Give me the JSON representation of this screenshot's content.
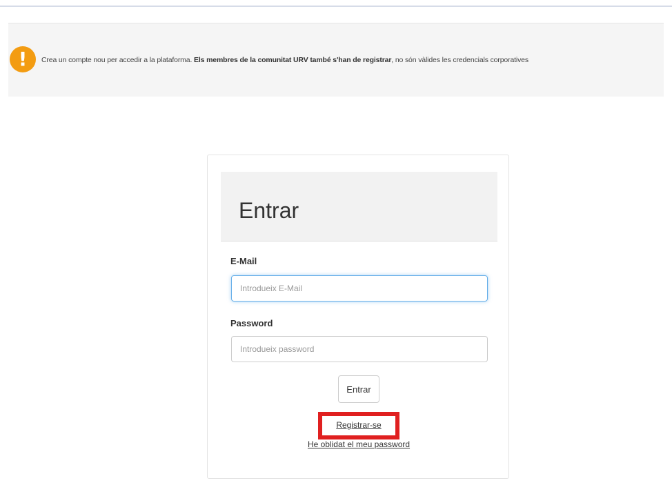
{
  "notice": {
    "icon": "exclamation-icon",
    "icon_glyph": "!",
    "icon_color": "#f39c12",
    "text_before": "Crea un compte nou per accedir a la plataforma. ",
    "text_bold": "Els membres de la comunitat URV també s'han de registrar",
    "text_after": ", no són vàlides les credencials corporatives"
  },
  "login": {
    "title": "Entrar",
    "email_label": "E-Mail",
    "email_placeholder": "Introdueix E-Mail",
    "email_value": "",
    "password_label": "Password",
    "password_placeholder": "Introdueix password",
    "password_value": "",
    "submit_label": "Entrar",
    "register_label": "Registrar-se",
    "forgot_label": "He oblidat el meu password",
    "highlight_color": "#e02020"
  }
}
